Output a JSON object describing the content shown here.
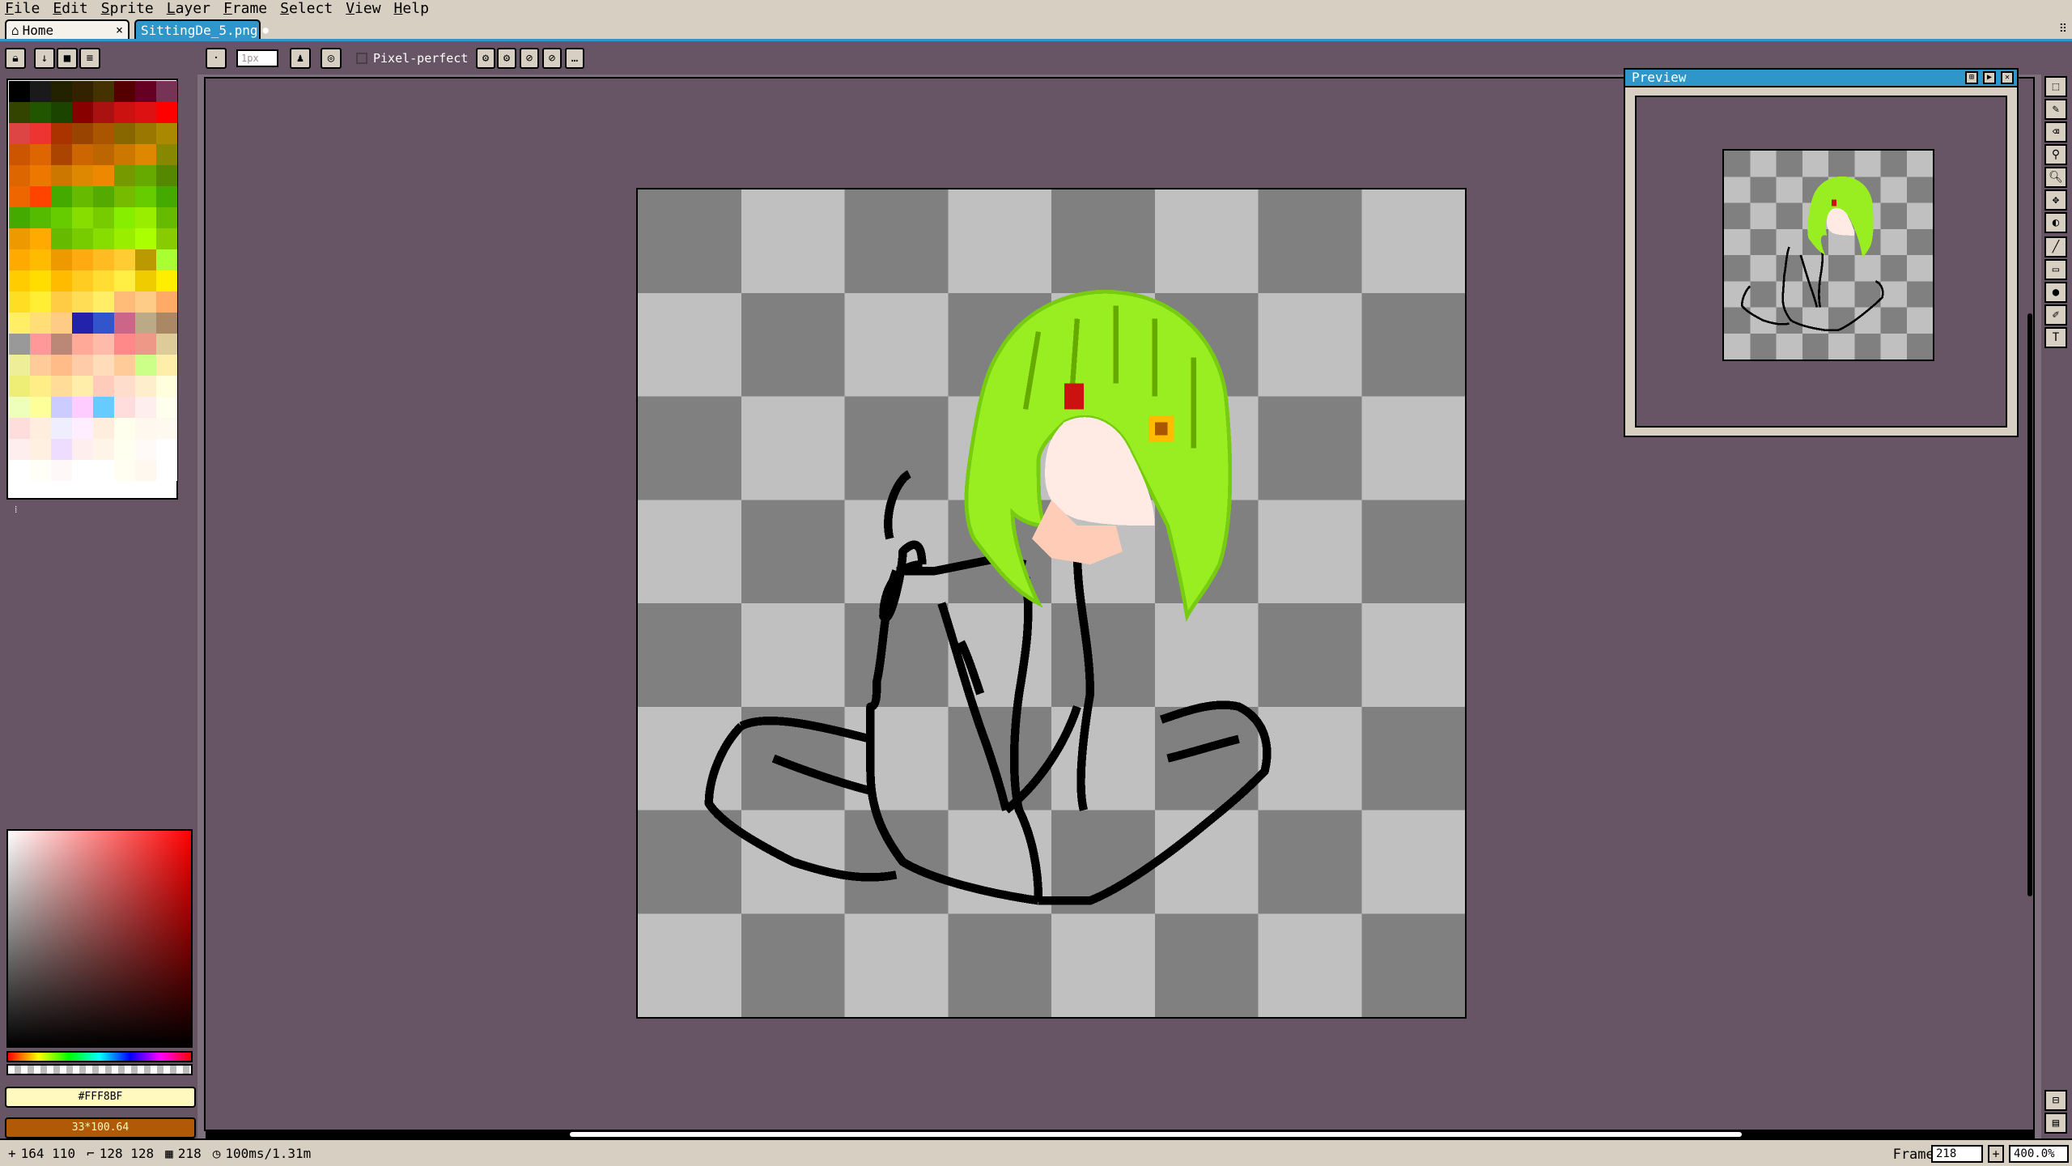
{
  "menu": [
    {
      "u": "F",
      "rest": "ile"
    },
    {
      "u": "E",
      "rest": "dit"
    },
    {
      "u": "S",
      "rest": "prite"
    },
    {
      "u": "L",
      "rest": "ayer"
    },
    {
      "u": "F",
      "rest": "rame"
    },
    {
      "u": "S",
      "rest": "elect"
    },
    {
      "u": "V",
      "rest": "iew"
    },
    {
      "u": "H",
      "rest": "elp"
    }
  ],
  "tabs": {
    "home": "Home",
    "file": "SittingDe_5.png",
    "close": "×",
    "modified": "●"
  },
  "toolbar": {
    "brush_size": "1px",
    "pixel_perfect": "Pixel-perfect"
  },
  "palette": {
    "colors": [
      "#000000",
      "#1a1a1a",
      "#222200",
      "#332200",
      "#443300",
      "#550000",
      "#660022",
      "#773355",
      "#334400",
      "#225500",
      "#1a4400",
      "#880000",
      "#aa1111",
      "#cc1111",
      "#dd1111",
      "#ff0000",
      "#dd4444",
      "#ee3333",
      "#aa3300",
      "#994400",
      "#aa5500",
      "#886600",
      "#997700",
      "#aa8800",
      "#cc5500",
      "#dd6600",
      "#aa4400",
      "#cc6600",
      "#bb6600",
      "#cc7700",
      "#dd8800",
      "#888800",
      "#dd6600",
      "#ee7700",
      "#cc7700",
      "#dd8800",
      "#ee8800",
      "#779900",
      "#66aa00",
      "#558800",
      "#ee6600",
      "#ff4400",
      "#44aa00",
      "#66bb00",
      "#55aa00",
      "#77bb00",
      "#66cc00",
      "#44aa00",
      "#44aa00",
      "#55bb00",
      "#66cc00",
      "#88dd00",
      "#77cc00",
      "#88ee00",
      "#99ee00",
      "#66bb00",
      "#ee9900",
      "#ffaa00",
      "#66bb00",
      "#77cc00",
      "#88dd00",
      "#99ee00",
      "#aaff00",
      "#88cc00",
      "#ffaa00",
      "#ffbb00",
      "#ee9900",
      "#ffaa11",
      "#ffbb22",
      "#ffcc33",
      "#bb9900",
      "#aaff33",
      "#ffcc00",
      "#ffdd00",
      "#ffbb00",
      "#ffcc22",
      "#ffdd33",
      "#ffee44",
      "#eecc00",
      "#ffee00",
      "#ffdd22",
      "#ffee33",
      "#ffcc44",
      "#ffdd55",
      "#ffee66",
      "#ffbb77",
      "#ffcc88",
      "#ffaa66",
      "#ffee66",
      "#ffdd77",
      "#ffcc88",
      "#2222aa",
      "#3355cc",
      "#cc6688",
      "#bbaa88",
      "#aa8866",
      "#999999",
      "#ff9999",
      "#bb8877",
      "#ffaa99",
      "#ffbbaa",
      "#ff8888",
      "#ee9988",
      "#ddcc99",
      "#eeee99",
      "#ffcc99",
      "#ffbb88",
      "#ffccaa",
      "#ffddbb",
      "#ffcc99",
      "#ccff88",
      "#ffeeaa",
      "#eeee77",
      "#ffee88",
      "#ffdd99",
      "#ffeeaa",
      "#ffccbb",
      "#ffddcc",
      "#ffeecc",
      "#ffffdd",
      "#eeffbb",
      "#ffff99",
      "#ccccff",
      "#ffccff",
      "#66ccff",
      "#ffdddd",
      "#ffeeee",
      "#ffffee",
      "#ffdddd",
      "#ffeedd",
      "#eeeeff",
      "#ffeeff",
      "#ffeedd",
      "#ffffee",
      "#fff8ee",
      "#fffaf0",
      "#ffeeee",
      "#fff0e0",
      "#eeddff",
      "#ffeeee",
      "#fff4e8",
      "#fffff0",
      "#fffaf8",
      "#ffffff",
      "#ffffff",
      "#fffff8",
      "#fff8f8",
      "#ffffff",
      "#ffffff",
      "#fffef0",
      "#fff8ee",
      "#ffffff"
    ]
  },
  "colors": {
    "fg_label": "#FFF8BF",
    "bg_label": "33*100.64",
    "fg_hex": "#fff8bf",
    "bg_hex": "#b05a08"
  },
  "preview": {
    "title": "Preview"
  },
  "status": {
    "coords": "164 110",
    "size": "128 128",
    "frames": "218",
    "duration": "100ms/1.31m",
    "frame_label": "Frame:",
    "frame_value": "218",
    "zoom": "400.0%"
  }
}
